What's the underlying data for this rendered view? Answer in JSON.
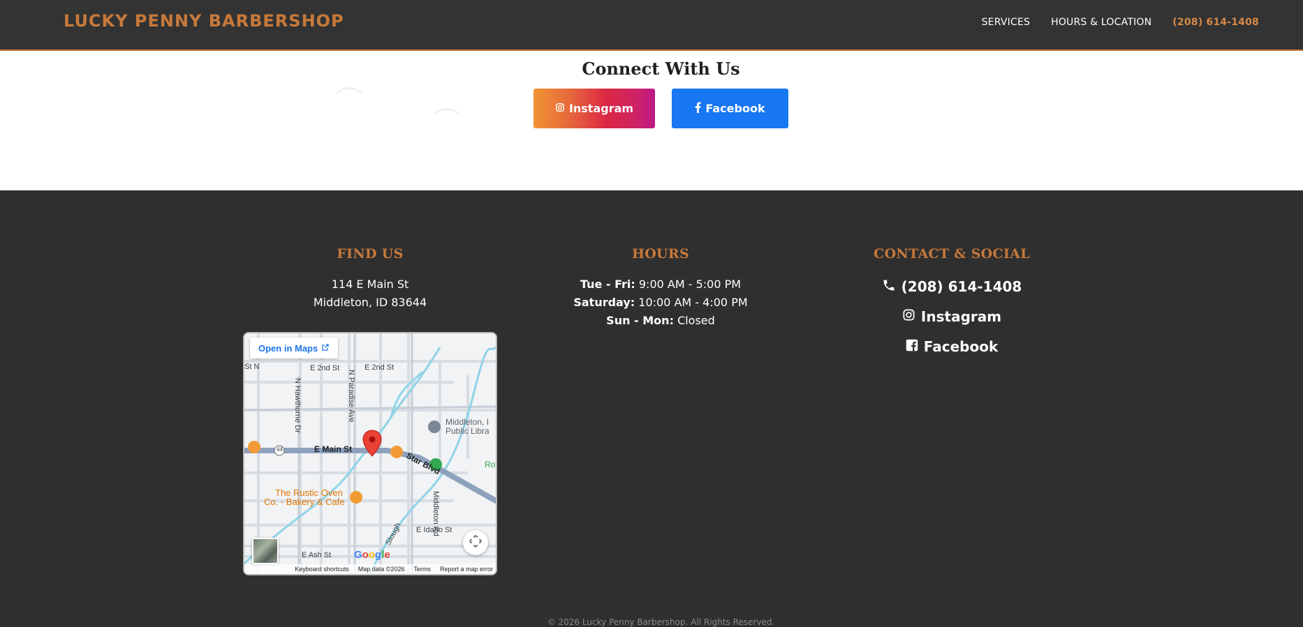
{
  "header": {
    "brand": "LUCKY PENNY BARBERSHOP",
    "nav": {
      "services": "SERVICES",
      "hours_location": "HOURS & LOCATION",
      "phone": "(208) 614-1408"
    }
  },
  "connect": {
    "title": "Connect With Us",
    "instagram_label": "Instagram",
    "facebook_label": "Facebook"
  },
  "footer": {
    "find_us": {
      "heading": "FIND US",
      "address_line1": "114 E Main St",
      "address_line2": "Middleton, ID 83644"
    },
    "map": {
      "open_label": "Open in Maps",
      "streets": {
        "e2nd_a": "E 2nd St",
        "e2nd_b": "E 2nd St",
        "st_n": "St N",
        "paradise": "N Paradise Ave",
        "hawthorne": "N Hawthorne Dr",
        "main": "E Main St",
        "star": "Star Blvd",
        "idaho": "E Idaho St",
        "ash": "E Ash St",
        "middleton_rd": "Middleton Rd",
        "slough": "Slough",
        "route": "44",
        "ro": "Ro"
      },
      "pois": {
        "library_line1": "Middleton, I",
        "library_line2": "Public Libra",
        "rustic_line1": "The Rustic Oven",
        "rustic_line2": "Co. - Bakery & Cafe"
      },
      "google": "Google",
      "footer_links": [
        "Keyboard shortcuts",
        "Map data ©2026",
        "Terms",
        "Report a map error"
      ]
    },
    "hours": {
      "heading": "HOURS",
      "rows": [
        {
          "day": "Tue - Fri:",
          "time": "9:00 AM - 5:00 PM"
        },
        {
          "day": "Saturday:",
          "time": "10:00 AM - 4:00 PM"
        },
        {
          "day": "Sun - Mon:",
          "time": "Closed"
        }
      ]
    },
    "contact": {
      "heading": "CONTACT & SOCIAL",
      "phone": "(208) 614-1408",
      "instagram": "Instagram",
      "facebook": "Facebook"
    },
    "copyright": "© 2026 Lucky Penny Barbershop. All Rights Reserved."
  },
  "colors": {
    "accent": "#c7793a",
    "header_bg": "#333333",
    "footer_bg": "#2f2f2f",
    "facebook_blue": "#1877f2"
  },
  "icons": [
    "instagram-icon",
    "facebook-icon",
    "phone-icon",
    "facebook-square-icon",
    "external-link-icon",
    "map-pin-icon",
    "recenter-icon"
  ]
}
